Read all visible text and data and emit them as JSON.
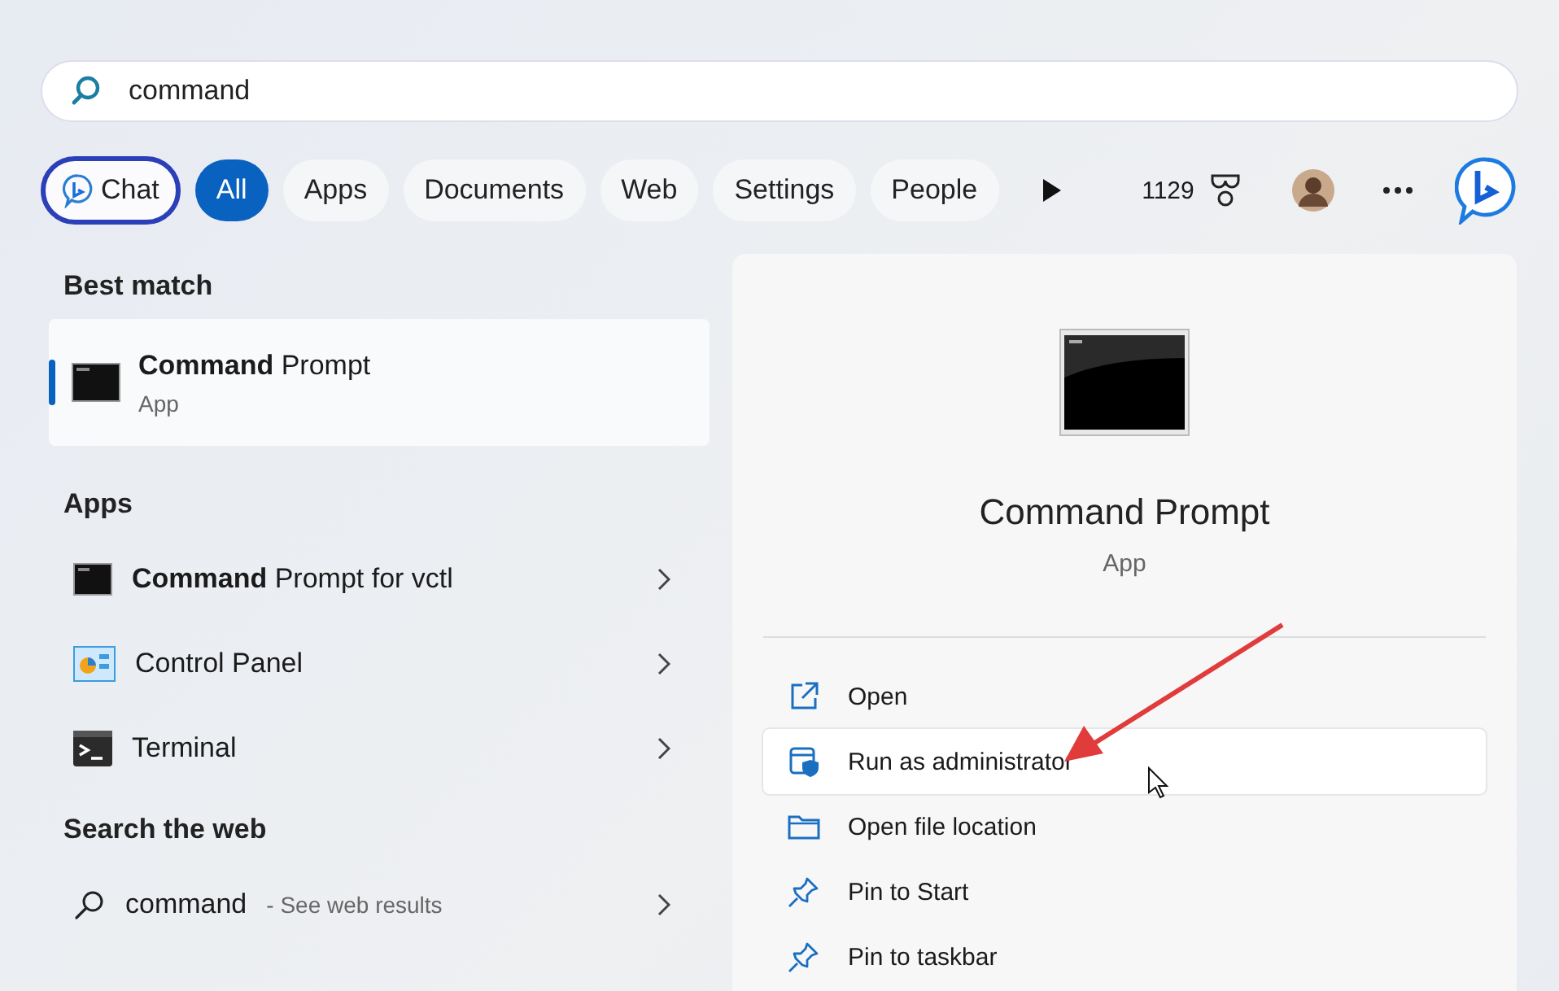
{
  "search": {
    "value": "command"
  },
  "filters": [
    {
      "label": "Chat",
      "kind": "chat",
      "selected": false
    },
    {
      "label": "All",
      "kind": "pill",
      "selected": true
    },
    {
      "label": "Apps",
      "kind": "pill",
      "selected": false
    },
    {
      "label": "Documents",
      "kind": "pill",
      "selected": false
    },
    {
      "label": "Web",
      "kind": "pill",
      "selected": false
    },
    {
      "label": "Settings",
      "kind": "pill",
      "selected": false
    },
    {
      "label": "People",
      "kind": "pill",
      "selected": false
    }
  ],
  "points": "1129",
  "best_match": {
    "heading": "Best match",
    "title": "**Command** Prompt",
    "subtitle": "App",
    "selected": true
  },
  "apps": {
    "heading": "Apps",
    "items": [
      {
        "title": "**Command** Prompt for vctl",
        "kind": "cmd"
      },
      {
        "title": "Control Panel",
        "kind": "control"
      },
      {
        "title": "Terminal",
        "kind": "terminal"
      }
    ]
  },
  "web": {
    "heading": "Search the web",
    "query": "command",
    "suffix": "- See web results"
  },
  "detail": {
    "title": "Command Prompt",
    "subtitle": "App",
    "actions": [
      {
        "label": "Open",
        "kind": "open",
        "hovered": false
      },
      {
        "label": "Run as administrator",
        "kind": "admin",
        "hovered": true
      },
      {
        "label": "Open file location",
        "kind": "folder",
        "hovered": false
      },
      {
        "label": "Pin to Start",
        "kind": "pin",
        "hovered": false
      },
      {
        "label": "Pin to taskbar",
        "kind": "pin",
        "hovered": false
      }
    ]
  }
}
